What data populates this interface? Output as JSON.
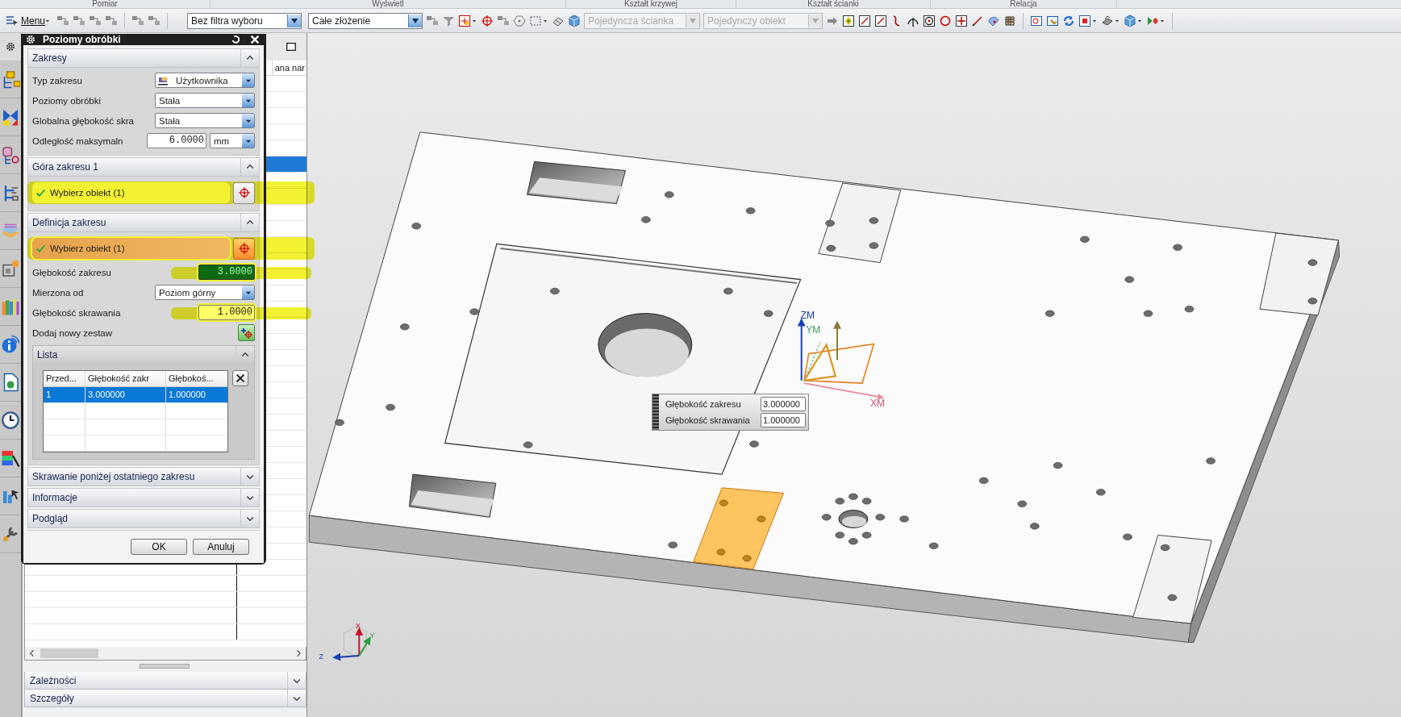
{
  "ribbon_groups": [
    "Pomiar",
    "Wyświetl",
    "Kształt krzywej",
    "Kształt ścianki",
    "Relacja"
  ],
  "toolbar": {
    "menu_label": "Menu",
    "dropdowns": [
      {
        "value": "Bez filtra wyboru",
        "disabled": false
      },
      {
        "value": "Całe złożenie",
        "disabled": false
      },
      {
        "value": "Pojedyncza ścianka",
        "disabled": true
      },
      {
        "value": "Pojedynczy obiekt",
        "disabled": true
      }
    ]
  },
  "navigator": {
    "column_header": "ana nar",
    "rows": [
      {
        "selected": false
      },
      {
        "selected": false
      },
      {
        "selected": false
      },
      {
        "selected": false
      },
      {
        "selected": false
      },
      {
        "selected": true
      },
      {
        "selected": false
      },
      {
        "selected": false
      },
      {
        "selected": false
      },
      {
        "selected": false
      },
      {
        "selected": false
      },
      {
        "selected": false
      },
      {
        "selected": false
      },
      {
        "selected": false
      },
      {
        "selected": false
      },
      {
        "selected": false
      },
      {
        "selected": false
      },
      {
        "selected": false
      },
      {
        "selected": false
      },
      {
        "selected": false
      },
      {
        "selected": false
      },
      {
        "selected": false
      },
      {
        "selected": false
      },
      {
        "selected": false
      },
      {
        "selected": false
      },
      {
        "selected": false
      },
      {
        "selected": false
      },
      {
        "selected": false
      },
      {
        "selected": false
      },
      {
        "selected": false
      },
      {
        "selected": false
      },
      {
        "selected": false
      },
      {
        "selected": false
      },
      {
        "selected": false
      },
      {
        "selected": false
      }
    ],
    "panels": [
      {
        "title": "Zależności",
        "expanded": false
      },
      {
        "title": "Szczegóły",
        "expanded": false
      }
    ]
  },
  "dialog": {
    "title": "Poziomy obróbki",
    "sections": [
      {
        "title": "Zakresy",
        "expanded": true,
        "rows": [
          {
            "kind": "iconselect",
            "label": "Typ zakresu",
            "value": "Użytkownika",
            "highlighted": false
          },
          {
            "kind": "select",
            "label": "Poziomy obróbki",
            "value": "Stała",
            "highlighted": false
          },
          {
            "kind": "select",
            "label": "Globalna głębokość skra",
            "value": "Stała",
            "highlighted": false
          },
          {
            "kind": "unitnumber",
            "label": "Odległość maksymaln",
            "value": "6.0000",
            "unit": "mm",
            "highlighted": false
          }
        ]
      },
      {
        "title": "Góra zakresu 1",
        "expanded": true,
        "rows": [
          {
            "kind": "pick",
            "label": "Wybierz obiekt (1)",
            "done": true,
            "active": false,
            "highlighted": true
          }
        ]
      },
      {
        "title": "Definicja zakresu",
        "expanded": true,
        "rows": [
          {
            "kind": "pick",
            "label": "Wybierz obiekt (1)",
            "done": true,
            "active": true,
            "highlighted": true
          },
          {
            "kind": "number",
            "label": "Głębokość zakresu",
            "value": "3.0000",
            "text_selected": true,
            "highlighted": true
          },
          {
            "kind": "select",
            "label": "Mierzona od",
            "value": "Poziom górny",
            "highlighted": false
          },
          {
            "kind": "number",
            "label": "Głębokość skrawania",
            "value": "1.0000",
            "text_selected": false,
            "highlighted": true
          },
          {
            "kind": "add",
            "label": "Dodaj nowy zestaw",
            "highlighted": false
          },
          {
            "kind": "list",
            "title": "Lista",
            "expanded": true,
            "columns": [
              "Przed...",
              "Głębokość zakr",
              "Głębokoś..."
            ],
            "rows": [
              {
                "cells": [
                  "1",
                  "3.000000",
                  "1.000000"
                ],
                "selected": true
              }
            ]
          }
        ]
      },
      {
        "title": "Skrawanie poniżej ostatniego zakresu",
        "expanded": false
      },
      {
        "title": "Informacje",
        "expanded": false
      },
      {
        "title": "Podgląd",
        "expanded": false
      }
    ],
    "buttons": [
      "OK",
      "Anuluj"
    ]
  },
  "viewport": {
    "csys_labels": [
      "ZM",
      "YM",
      "XM"
    ],
    "triad_labels": [
      "X",
      "Y",
      "Z"
    ],
    "onscreen_input": [
      {
        "label": "Głębokość zakresu",
        "value": "3.000000"
      },
      {
        "label": "Głębokość skrawania",
        "value": "1.000000"
      }
    ]
  }
}
